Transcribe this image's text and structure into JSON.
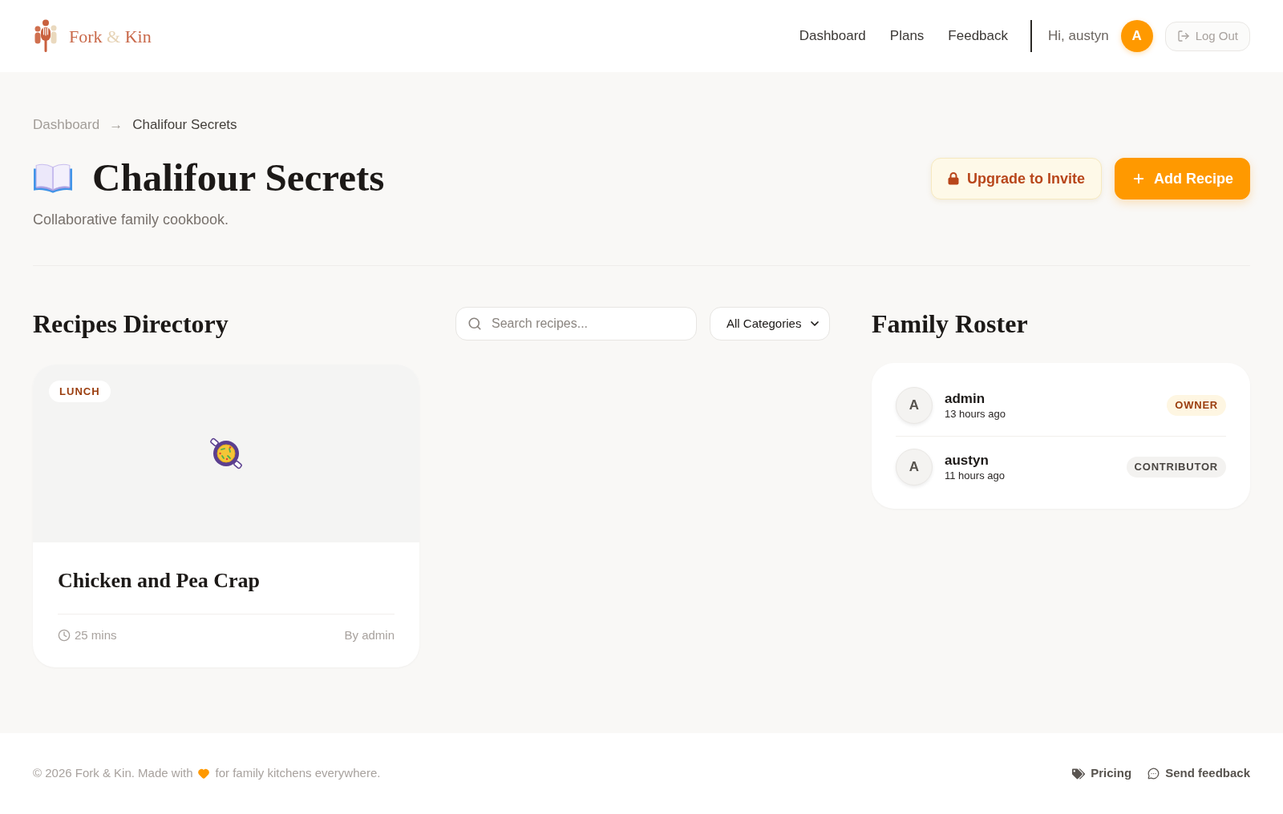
{
  "header": {
    "logo": {
      "first": "Fork",
      "joiner": "&",
      "last": "Kin"
    },
    "nav": [
      "Dashboard",
      "Plans",
      "Feedback"
    ],
    "greeting": "Hi, austyn",
    "avatar_initial": "A",
    "logout": "Log Out"
  },
  "breadcrumb": {
    "items": [
      {
        "label": "Dashboard",
        "current": false
      },
      {
        "label": "Chalifour Secrets",
        "current": true
      }
    ],
    "separator": "→"
  },
  "page": {
    "title": "Chalifour Secrets",
    "subtitle": "Collaborative family cookbook.",
    "actions": [
      {
        "label": "Upgrade to Invite",
        "kind": "locked"
      },
      {
        "label": "Add Recipe",
        "kind": "primary"
      }
    ]
  },
  "recipes": {
    "heading": "Recipes Directory",
    "search": {
      "placeholder": "Search recipes..."
    },
    "category_select": {
      "value": "All Categories"
    },
    "cards": [
      {
        "category": "LUNCH",
        "title": "Chicken and Pea Crap",
        "time": "25 mins",
        "author": "By admin"
      }
    ]
  },
  "roster": {
    "heading": "Family Roster",
    "members": [
      {
        "initial": "A",
        "name": "admin",
        "last_seen": "13 hours ago",
        "role": "OWNER",
        "kind": "owner"
      },
      {
        "initial": "A",
        "name": "austyn",
        "last_seen": "11 hours ago",
        "role": "CONTRIBUTOR",
        "kind": "contributor"
      }
    ]
  },
  "footer": {
    "text_before": "© 2026 Fork & Kin. Made with",
    "text_after": "for family kitchens everywhere.",
    "links": [
      {
        "label": "Pricing",
        "kind": "pricing"
      },
      {
        "label": "Send feedback",
        "kind": "feedback"
      }
    ]
  }
}
